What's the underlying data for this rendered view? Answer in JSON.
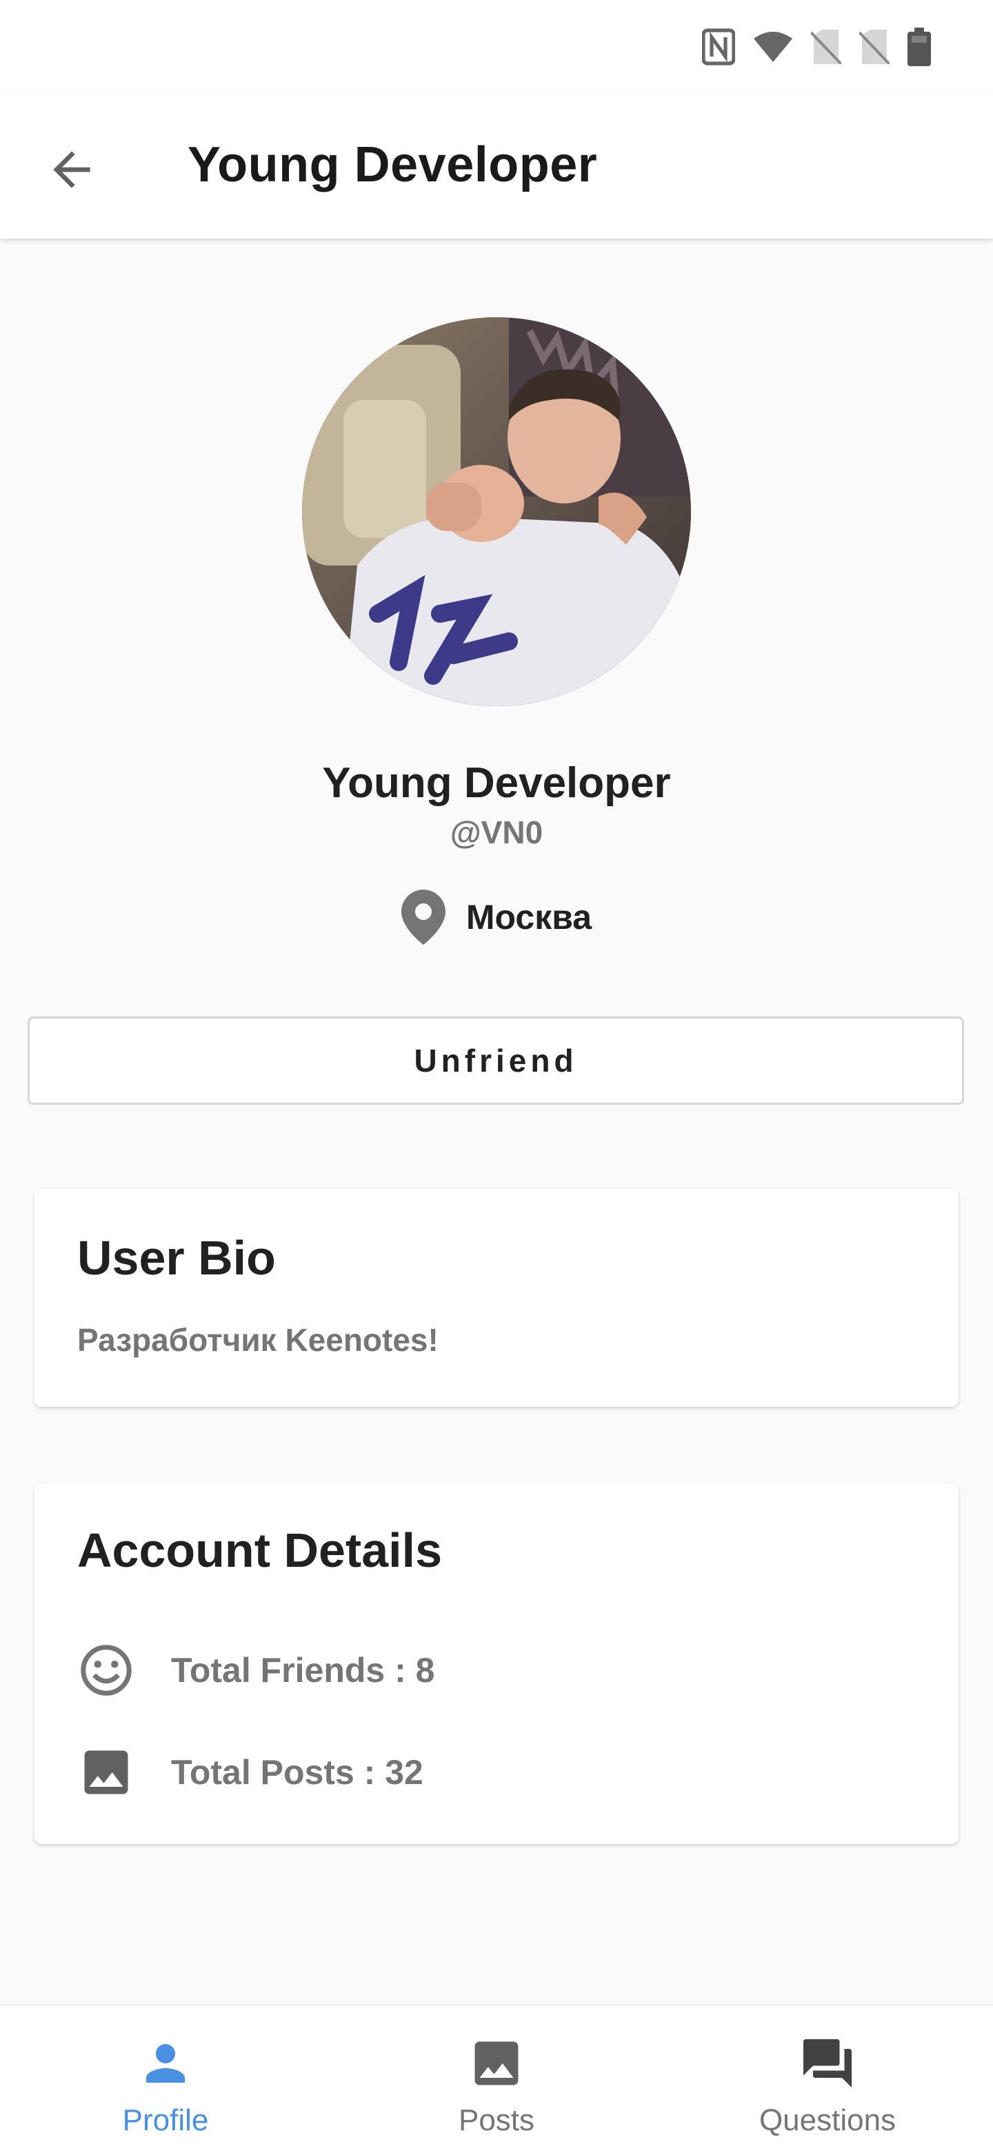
{
  "status_bar": {
    "icons": [
      "nfc-icon",
      "wifi-icon",
      "no-sim-icon",
      "no-sim-icon",
      "battery-icon"
    ]
  },
  "app_bar": {
    "back_icon": "arrow-left-icon",
    "title": "Young Developer"
  },
  "profile": {
    "avatar": "profile-photo",
    "display_name": "Young Developer",
    "username": "@VN0",
    "location_icon": "location-pin-icon",
    "location": "Москва",
    "action_label": "Unfriend"
  },
  "bio": {
    "title": "User Bio",
    "text": "Разработчик Keenotes!"
  },
  "account": {
    "title": "Account Details",
    "friends_icon": "smiley-face-icon",
    "friends": "Total Friends : 8",
    "posts_icon": "image-icon",
    "posts": "Total Posts : 32"
  },
  "bottom_nav": {
    "items": [
      {
        "label": "Profile",
        "icon": "person-icon",
        "active": true
      },
      {
        "label": "Posts",
        "icon": "image-icon",
        "active": false
      },
      {
        "label": "Questions",
        "icon": "forum-icon",
        "active": false
      }
    ]
  },
  "colors": {
    "accent": "#4a90e2",
    "secondary_text": "#757575",
    "primary_text": "#212121",
    "background": "#fafafa"
  }
}
